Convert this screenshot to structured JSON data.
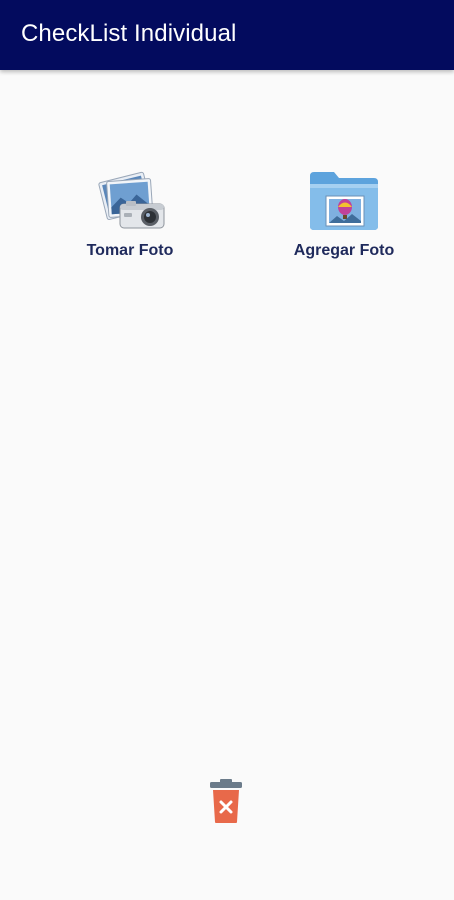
{
  "app_bar": {
    "title": "CheckList Individual",
    "background": "#030b5e"
  },
  "actions": [
    {
      "label": "Tomar Foto",
      "icon": "camera-photos-icon"
    },
    {
      "label": "Agregar Foto",
      "icon": "photo-folder-icon"
    }
  ],
  "trash": {
    "icon": "delete-trash-icon",
    "color": "#e8694a"
  }
}
